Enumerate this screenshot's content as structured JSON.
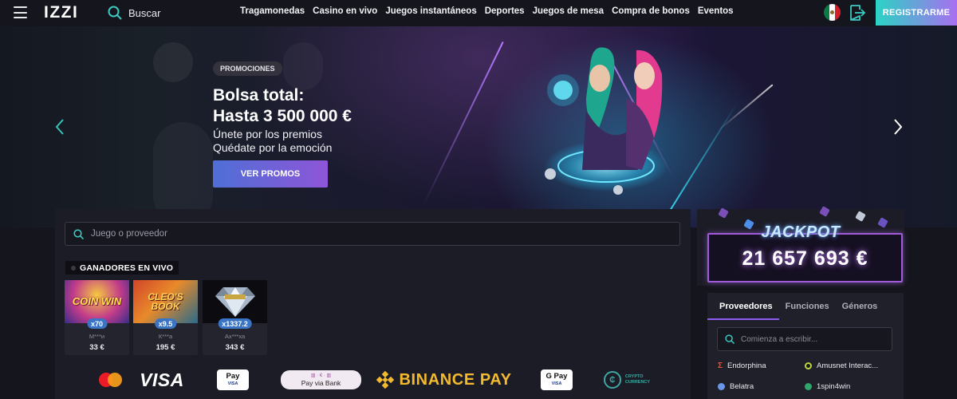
{
  "header": {
    "logo": "IZZI",
    "search_label": "Buscar",
    "nav": [
      "Tragamonedas",
      "Casino en vivo",
      "Juegos instantáneos",
      "Deportes",
      "Juegos de mesa",
      "Compra de bonos",
      "Eventos"
    ],
    "register_label": "REGISTRARME",
    "flag_icon": "mexico-flag-icon",
    "login_icon": "login-icon"
  },
  "hero": {
    "badge": "PROMOCIONES",
    "title_line1": "Bolsa total:",
    "title_line2": "Hasta 3 500 000 €",
    "sub_line1": "Únete por los premios",
    "sub_line2": "Quédate por la emoción",
    "cta": "VER PROMOS"
  },
  "games": {
    "search_placeholder": "Juego o proveedor",
    "live_winners_title": "GANADORES EN VIVO",
    "winners": [
      {
        "game": "COIN WIN",
        "multiplier": "x70",
        "user": "M***и",
        "amount": "33 €"
      },
      {
        "game": "CLEO'S BOOK",
        "multiplier": "x9.5",
        "user": "К***а",
        "amount": "195 €"
      },
      {
        "game": "",
        "multiplier": "x1337.2",
        "user": "Ах***ха",
        "amount": "343 €"
      }
    ]
  },
  "payments": {
    "visa": "VISA",
    "apple_pay_top": "Pay",
    "apple_pay_bottom": "VISA",
    "pay_via_bank": "Pay via Bank",
    "binance": "BINANCE PAY",
    "google_pay_top": "G Pay",
    "google_pay_bottom": "VISA",
    "crypto_line1": "CRYPTO",
    "crypto_line2": "CURRENCY"
  },
  "jackpot": {
    "title": "JACKPOT",
    "amount": "21 657 693 €"
  },
  "providers": {
    "tabs": [
      "Proveedores",
      "Funciones",
      "Géneros"
    ],
    "search_placeholder": "Comienza a escribir...",
    "items": [
      "Endorphina",
      "Amusnet Interac...",
      "Belatra",
      "1spin4win"
    ]
  },
  "colors": {
    "accent_purple": "#8c5cf0",
    "register_gradient_start": "#2ad3c4",
    "register_gradient_end": "#a86ff0",
    "multiplier_blue": "#3a74c4",
    "binance_yellow": "#f3ba2f"
  }
}
